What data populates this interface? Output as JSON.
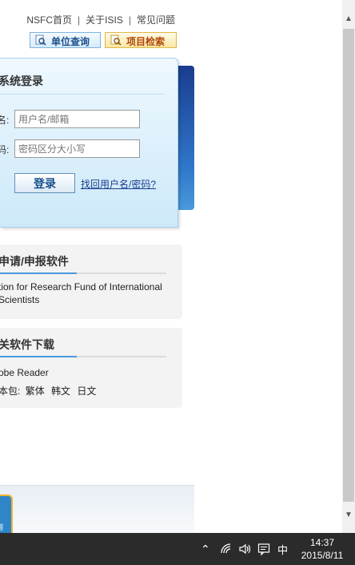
{
  "header": {
    "links": [
      "NSFC首页",
      "关于ISIS",
      "常见问题"
    ],
    "unit_query": "单位查询",
    "project_search": "项目检索"
  },
  "login": {
    "title": "系统登录",
    "username_label": "名:",
    "password_label": "码:",
    "username_placeholder": "用户名/邮箱",
    "password_placeholder": "密码区分大小写",
    "login_button": "登录",
    "forgot_link": "找回用户名/密码?"
  },
  "apply": {
    "title": "申请/申报软件",
    "line1": "tion for Research Fund of International",
    "line2": "Scientists"
  },
  "download": {
    "title": "关软件下载",
    "line1": "obe Reader",
    "line2_prefix": "本包:",
    "items": [
      "繁体",
      "韩文",
      "日文"
    ]
  },
  "footer": {
    "badge_text": "询"
  },
  "taskbar": {
    "ime": "中",
    "time": "14:37",
    "date": "2015/8/11"
  },
  "icons": [
    "search-icon",
    "chevron-up-icon",
    "wifi-icon",
    "volume-icon",
    "message-icon"
  ]
}
